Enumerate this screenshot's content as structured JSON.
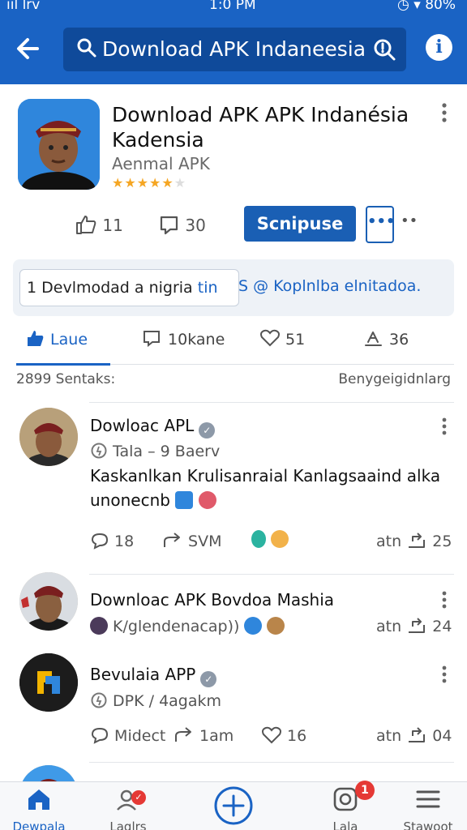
{
  "status": {
    "left": "ııl lrv",
    "time": "1:0 PM",
    "right": "◷ ▾ 80%"
  },
  "header": {
    "search_text": "Download APK Indaneesia"
  },
  "app": {
    "title": "Download APK APK Indanésia Kadensia",
    "subtitle": "Aenmal APK",
    "rating_stars": 5,
    "likes": "11",
    "saves": "30",
    "primary_button": "Scnipuse",
    "more_button": "•••",
    "more_dots": "••"
  },
  "chips": {
    "chip1_prefix": "1 Devlmodad a nigria ",
    "chip1_accent": "tin",
    "chip2": "S @ Koplnlba elnitadoa."
  },
  "tabs": [
    {
      "label": "Laue",
      "active": true
    },
    {
      "label": "10kane",
      "active": false
    },
    {
      "label": "51",
      "active": false
    },
    {
      "label": "36",
      "active": false
    }
  ],
  "list_header": {
    "count": "2899 Sentaks:",
    "right": "Benygeigidnlarg"
  },
  "posts": [
    {
      "name": "Dowloac APL",
      "meta": "Tala – 9 Baerv",
      "body": "Kaskanlkan Krulisanraial Kanlagsaaind alka unonecnb",
      "comments": "18",
      "shares": "SVM",
      "time": "atn",
      "reposts": "25"
    },
    {
      "name": "Downloac APK Bovdoa Mashia",
      "meta": "K/glendenacap))",
      "time": "atn",
      "reposts": "24"
    },
    {
      "name": "Bevulaia APP",
      "meta": "DPK / 4agakm",
      "comments": "Midect",
      "shares": "1am",
      "likes": "16",
      "time": "atn",
      "reposts": "04"
    }
  ],
  "bottom_nav": [
    {
      "label": "Dewpala",
      "icon": "home-icon"
    },
    {
      "label": "Laglrs",
      "icon": "people-icon"
    },
    {
      "label": "",
      "icon": "add-circle-icon"
    },
    {
      "label": "Lala",
      "icon": "instagram-icon",
      "badge": "1"
    },
    {
      "label": "Stawoot",
      "icon": "list-icon"
    }
  ],
  "colors": {
    "brand": "#1a63c4",
    "primary_button": "#1a5fb4",
    "star": "#f5a623",
    "badge": "#e53935"
  }
}
